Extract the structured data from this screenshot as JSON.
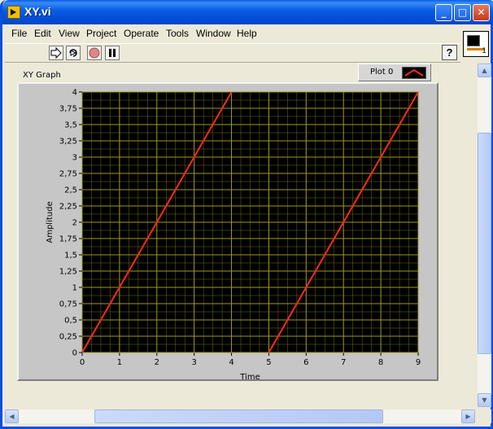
{
  "window": {
    "title": "XY.vi"
  },
  "title_buttons": {
    "minimize": "_",
    "maximize": "□",
    "close": "✕"
  },
  "menu": [
    {
      "label": "File"
    },
    {
      "label": "Edit"
    },
    {
      "label": "View"
    },
    {
      "label": "Project"
    },
    {
      "label": "Operate"
    },
    {
      "label": "Tools"
    },
    {
      "label": "Window"
    },
    {
      "label": "Help"
    }
  ],
  "toolbar": {
    "icons": [
      "run-arrow-icon",
      "run-continuously-icon",
      "abort-execution-icon",
      "pause-icon"
    ],
    "help_label": "?"
  },
  "vi_icon": {
    "label": "1"
  },
  "graph": {
    "label": "XY Graph",
    "legend": {
      "name": "Plot 0"
    }
  },
  "colors": {
    "plot": "#ff2a1a",
    "grid": "#9e9a1c",
    "plot_background": "#000000",
    "titlebar": "#0a5de8"
  },
  "chart_data": {
    "type": "line",
    "title": "",
    "xlabel": "Time",
    "ylabel": "Amplitude",
    "xlim": [
      0,
      9
    ],
    "ylim": [
      0,
      4
    ],
    "grid": true,
    "x_ticks": [
      "0",
      "1",
      "2",
      "3",
      "4",
      "5",
      "6",
      "7",
      "8",
      "9"
    ],
    "y_ticks": [
      "0",
      "0,25",
      "0,5",
      "0,75",
      "1",
      "1,25",
      "1,5",
      "1,75",
      "2",
      "2,25",
      "2,5",
      "2,75",
      "3",
      "3,25",
      "3,5",
      "3,75",
      "4"
    ],
    "series": [
      {
        "name": "Plot 0",
        "segments": [
          [
            [
              0,
              0
            ],
            [
              4,
              4
            ]
          ],
          [
            [
              5,
              0
            ],
            [
              9,
              4
            ]
          ]
        ]
      }
    ]
  }
}
